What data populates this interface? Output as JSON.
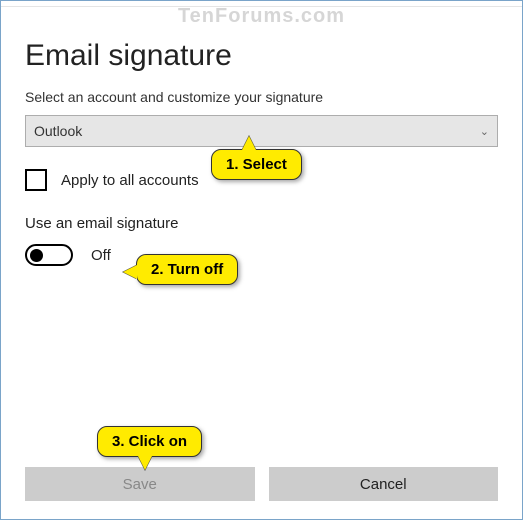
{
  "watermark": "TenForums.com",
  "header": {
    "title": "Email signature",
    "subtitle": "Select an account and customize your signature"
  },
  "account_select": {
    "value": "Outlook"
  },
  "apply_all": {
    "label": "Apply to all accounts",
    "checked": false
  },
  "use_signature": {
    "label": "Use an email signature",
    "state": "Off"
  },
  "buttons": {
    "save": "Save",
    "cancel": "Cancel"
  },
  "callouts": {
    "select": "1. Select",
    "turn_off": "2. Turn off",
    "click_on": "3. Click on"
  }
}
